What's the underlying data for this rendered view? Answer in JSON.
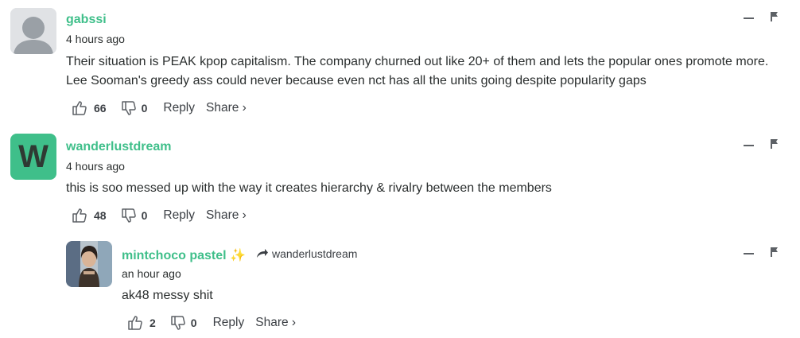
{
  "comments": [
    {
      "username": "gabssi",
      "time": "4 hours ago",
      "text": "Their situation is PEAK kpop capitalism. The company churned out like 20+ of them and lets the popular ones promote more. Lee Sooman's greedy ass could never because even nct has all the units going despite popularity gaps",
      "upvotes": "66",
      "downvotes": "0",
      "reply_label": "Reply",
      "share_label": "Share ›"
    },
    {
      "username": "wanderlustdream",
      "avatar_letter": "W",
      "avatar_color": "#3fbf8a",
      "time": "4 hours ago",
      "text": "this is soo messed up with the way it creates hierarchy & rivalry between the members",
      "upvotes": "48",
      "downvotes": "0",
      "reply_label": "Reply",
      "share_label": "Share ›"
    },
    {
      "username": "mintchoco pastel",
      "username_emoji": "✨",
      "replying_to": "wanderlustdream",
      "time": "an hour ago",
      "text": "ak48 messy shit",
      "upvotes": "2",
      "downvotes": "0",
      "reply_label": "Reply",
      "share_label": "Share ›"
    }
  ],
  "colors": {
    "accent": "#3fbf8a",
    "text": "#2a2e2e",
    "muted_icon": "#5d6166"
  },
  "icons": [
    "thumbs-up-icon",
    "thumbs-down-icon",
    "flag-icon",
    "collapse-icon",
    "reply-arrow-icon",
    "sparkles-icon",
    "default-avatar-icon"
  ]
}
